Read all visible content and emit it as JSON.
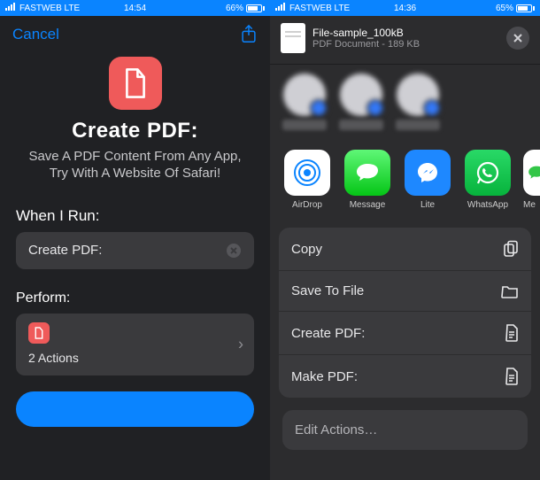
{
  "left": {
    "status": {
      "carrier": "FASTWEB LTE",
      "time": "14:54",
      "battery": "66%"
    },
    "cancel": "Cancel",
    "title": "Create PDF:",
    "subtitle": "Save A PDF Content From Any App, Try With A Website Of Safari!",
    "when_label": "When I Run:",
    "when_value": "Create PDF:",
    "perform_label": "Perform:",
    "actions_count": "2 Actions"
  },
  "right": {
    "status": {
      "carrier": "FASTWEB LTE",
      "time": "14:36",
      "battery": "65%"
    },
    "doc": {
      "name": "File-sample_100kB",
      "meta": "PDF Document - 189 KB"
    },
    "apps": [
      {
        "label": "AirDrop"
      },
      {
        "label": "Message"
      },
      {
        "label": "Lite"
      },
      {
        "label": "WhatsApp"
      },
      {
        "label": "Me"
      }
    ],
    "actions": {
      "copy": "Copy",
      "save": "Save To File",
      "create": "Create PDF:",
      "make": "Make PDF:"
    },
    "edit": "Edit Actions…"
  }
}
